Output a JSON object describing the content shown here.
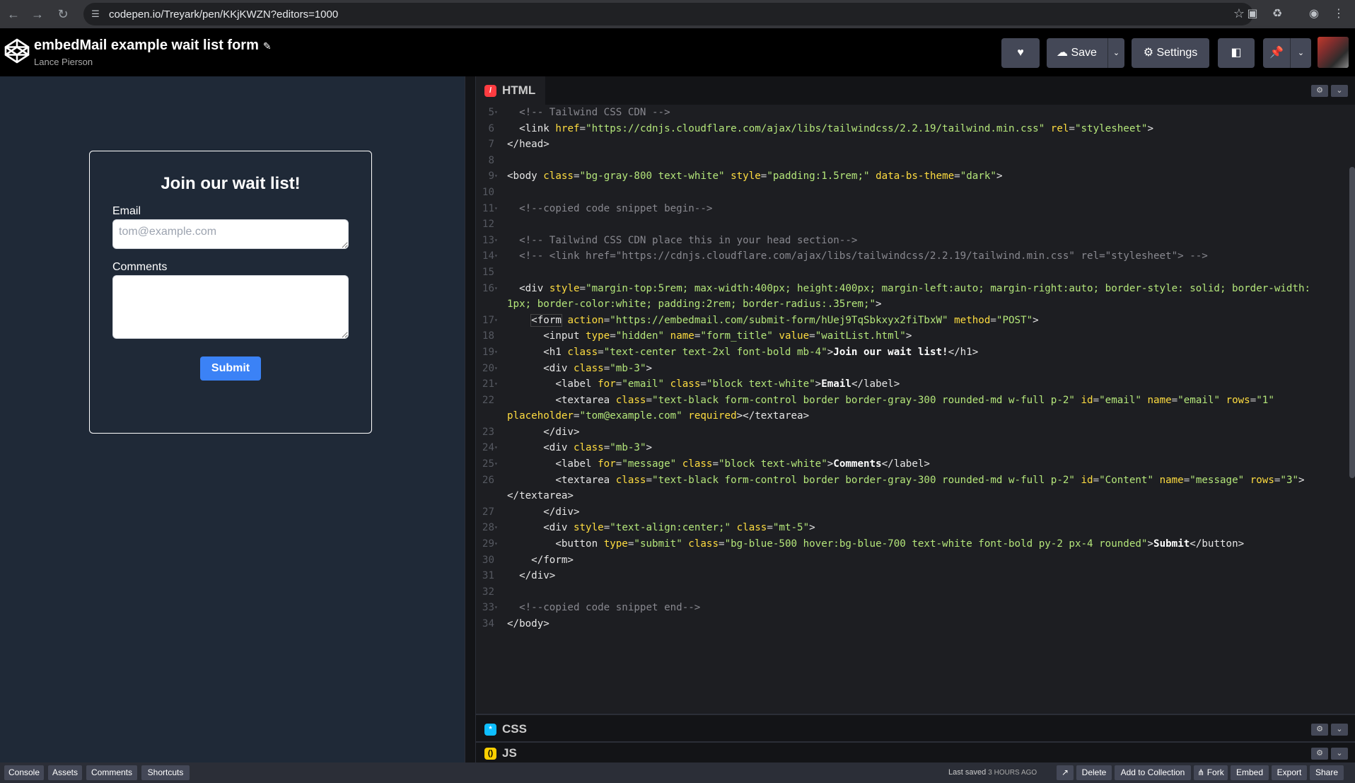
{
  "browser": {
    "url": "codepen.io/Treyark/pen/KKjKWZN?editors=1000"
  },
  "header": {
    "title": "embedMail example wait list form",
    "author": "Lance Pierson",
    "save_label": "Save",
    "settings_label": "Settings"
  },
  "preview": {
    "heading": "Join our wait list!",
    "email_label": "Email",
    "email_placeholder": "tom@example.com",
    "comments_label": "Comments",
    "submit_label": "Submit"
  },
  "editor": {
    "html_tab": "HTML",
    "css_tab": "CSS",
    "js_tab": "JS",
    "lines": [
      {
        "n": "5",
        "fold": true,
        "html": "  <span class='c'>&lt;!-- Tailwind CSS CDN --&gt;</span>"
      },
      {
        "n": "6",
        "fold": false,
        "html": "  <span class='t'>&lt;link</span> <span class='a'>href</span>=<span class='s'>\"https://cdnjs.cloudflare.com/ajax/libs/tailwindcss/2.2.19/tailwind.min.css\"</span> <span class='a'>rel</span>=<span class='s'>\"stylesheet\"</span><span class='t'>&gt;</span>"
      },
      {
        "n": "7",
        "fold": false,
        "html": "<span class='t'>&lt;/head&gt;</span>"
      },
      {
        "n": "8",
        "fold": false,
        "html": ""
      },
      {
        "n": "9",
        "fold": true,
        "html": "<span class='t'>&lt;body</span> <span class='a'>class</span>=<span class='s'>\"bg-gray-800 text-white\"</span> <span class='a'>style</span>=<span class='s'>\"padding:1.5rem;\"</span> <span class='a'>data-bs-theme</span>=<span class='s'>\"dark\"</span><span class='t'>&gt;</span>"
      },
      {
        "n": "10",
        "fold": false,
        "html": ""
      },
      {
        "n": "11",
        "fold": true,
        "html": "  <span class='c'>&lt;!--copied code snippet begin--&gt;</span>"
      },
      {
        "n": "12",
        "fold": false,
        "html": ""
      },
      {
        "n": "13",
        "fold": true,
        "html": "  <span class='c'>&lt;!-- Tailwind CSS CDN place this in your head section--&gt;</span>"
      },
      {
        "n": "14",
        "fold": true,
        "html": "  <span class='c'>&lt;!-- &lt;link href=\"https://cdnjs.cloudflare.com/ajax/libs/tailwindcss/2.2.19/tailwind.min.css\" rel=\"stylesheet\"&gt; --&gt;</span>"
      },
      {
        "n": "15",
        "fold": false,
        "html": ""
      },
      {
        "n": "16",
        "fold": true,
        "html": "  <span class='t'>&lt;div</span> <span class='a'>style</span>=<span class='s'>\"margin-top:5rem; max-width:400px; height:400px; margin-left:auto; margin-right:auto; border-style: solid; border-width: 1px; border-color:white; padding:2rem; border-radius:.35rem;\"</span><span class='t'>&gt;</span>"
      },
      {
        "n": "17",
        "fold": true,
        "hl": true,
        "html": "    <span class='t'>&lt;form</span> <span class='a'>action</span>=<span class='s'>\"https://embedmail.com/submit-form/hUej9TqSbkxyx2fiTbxW\"</span> <span class='a'>method</span>=<span class='s'>\"POST\"</span><span class='t'>&gt;</span>"
      },
      {
        "n": "18",
        "fold": false,
        "html": "      <span class='t'>&lt;input</span> <span class='a'>type</span>=<span class='s'>\"hidden\"</span> <span class='a'>name</span>=<span class='s'>\"form_title\"</span> <span class='a'>value</span>=<span class='s'>\"waitList.html\"</span><span class='t'>&gt;</span>"
      },
      {
        "n": "19",
        "fold": true,
        "html": "      <span class='t'>&lt;h1</span> <span class='a'>class</span>=<span class='s'>\"text-center text-2xl font-bold mb-4\"</span><span class='t'>&gt;</span><span class='x'>Join our wait list!</span><span class='t'>&lt;/h1&gt;</span>"
      },
      {
        "n": "20",
        "fold": true,
        "html": "      <span class='t'>&lt;div</span> <span class='a'>class</span>=<span class='s'>\"mb-3\"</span><span class='t'>&gt;</span>"
      },
      {
        "n": "21",
        "fold": true,
        "html": "        <span class='t'>&lt;label</span> <span class='a'>for</span>=<span class='s'>\"email\"</span> <span class='a'>class</span>=<span class='s'>\"block text-white\"</span><span class='t'>&gt;</span><span class='x'>Email</span><span class='t'>&lt;/label&gt;</span>"
      },
      {
        "n": "22",
        "fold": false,
        "html": "        <span class='t'>&lt;textarea</span> <span class='a'>class</span>=<span class='s'>\"text-black form-control border border-gray-300 rounded-md w-full p-2\"</span> <span class='a'>id</span>=<span class='s'>\"email\"</span> <span class='a'>name</span>=<span class='s'>\"email\"</span> <span class='a'>rows</span>=<span class='s'>\"1\"</span> <span class='a'>placeholder</span>=<span class='s'>\"tom@example.com\"</span> <span class='a'>required</span><span class='t'>&gt;&lt;/textarea&gt;</span>"
      },
      {
        "n": "23",
        "fold": false,
        "html": "      <span class='t'>&lt;/div&gt;</span>"
      },
      {
        "n": "24",
        "fold": true,
        "html": "      <span class='t'>&lt;div</span> <span class='a'>class</span>=<span class='s'>\"mb-3\"</span><span class='t'>&gt;</span>"
      },
      {
        "n": "25",
        "fold": true,
        "html": "        <span class='t'>&lt;label</span> <span class='a'>for</span>=<span class='s'>\"message\"</span> <span class='a'>class</span>=<span class='s'>\"block text-white\"</span><span class='t'>&gt;</span><span class='x'>Comments</span><span class='t'>&lt;/label&gt;</span>"
      },
      {
        "n": "26",
        "fold": false,
        "html": "        <span class='t'>&lt;textarea</span> <span class='a'>class</span>=<span class='s'>\"text-black form-control border border-gray-300 rounded-md w-full p-2\"</span> <span class='a'>id</span>=<span class='s'>\"Content\"</span> <span class='a'>name</span>=<span class='s'>\"message\"</span> <span class='a'>rows</span>=<span class='s'>\"3\"</span><span class='t'>&gt;</span> <span class='t'>&lt;/textarea&gt;</span>"
      },
      {
        "n": "27",
        "fold": false,
        "html": "      <span class='t'>&lt;/div&gt;</span>"
      },
      {
        "n": "28",
        "fold": true,
        "html": "      <span class='t'>&lt;div</span> <span class='a'>style</span>=<span class='s'>\"text-align:center;\"</span> <span class='a'>class</span>=<span class='s'>\"mt-5\"</span><span class='t'>&gt;</span>"
      },
      {
        "n": "29",
        "fold": true,
        "html": "        <span class='t'>&lt;button</span> <span class='a'>type</span>=<span class='s'>\"submit\"</span> <span class='a'>class</span>=<span class='s'>\"bg-blue-500 hover:bg-blue-700 text-white font-bold py-2 px-4 rounded\"</span><span class='t'>&gt;</span><span class='x'>Submit</span><span class='t'>&lt;/button&gt;</span>"
      },
      {
        "n": "30",
        "fold": false,
        "html": "    <span class='t'>&lt;/form&gt;</span>"
      },
      {
        "n": "31",
        "fold": false,
        "html": "  <span class='t'>&lt;/div&gt;</span>"
      },
      {
        "n": "32",
        "fold": false,
        "html": ""
      },
      {
        "n": "33",
        "fold": true,
        "html": "  <span class='c'>&lt;!--copied code snippet end--&gt;</span>"
      },
      {
        "n": "34",
        "fold": false,
        "html": "<span class='t'>&lt;/body&gt;</span>"
      }
    ]
  },
  "footer": {
    "console": "Console",
    "assets": "Assets",
    "comments": "Comments",
    "shortcuts": "Shortcuts",
    "last_saved": "Last saved",
    "last_saved_ago": "3 HOURS AGO",
    "delete": "Delete",
    "add_to_collection": "Add to Collection",
    "fork": "Fork",
    "embed": "Embed",
    "export": "Export",
    "share": "Share"
  },
  "colors": {
    "preview_bg": "#1f2937",
    "submit_bg": "#3b82f6",
    "html_badge": "#ff3c41",
    "css_badge": "#0ebeff",
    "js_badge": "#fcd000"
  }
}
